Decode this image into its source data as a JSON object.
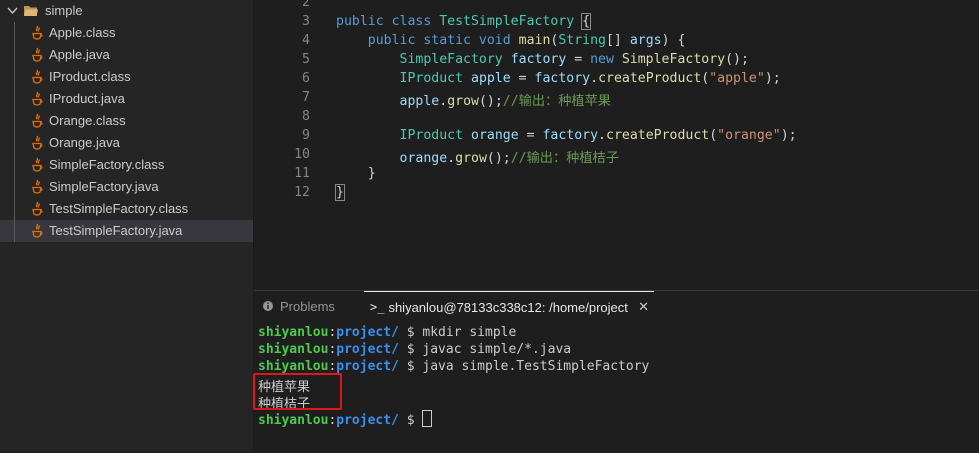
{
  "explorer": {
    "folder": "simple",
    "files": [
      {
        "name": "Apple.class",
        "active": false
      },
      {
        "name": "Apple.java",
        "active": false
      },
      {
        "name": "IProduct.class",
        "active": false
      },
      {
        "name": "IProduct.java",
        "active": false
      },
      {
        "name": "Orange.class",
        "active": false
      },
      {
        "name": "Orange.java",
        "active": false
      },
      {
        "name": "SimpleFactory.class",
        "active": false
      },
      {
        "name": "SimpleFactory.java",
        "active": false
      },
      {
        "name": "TestSimpleFactory.class",
        "active": false
      },
      {
        "name": "TestSimpleFactory.java",
        "active": true
      }
    ]
  },
  "editor": {
    "lines": [
      {
        "n": "2",
        "tokens": []
      },
      {
        "n": "3",
        "tokens": [
          [
            "kw",
            "public "
          ],
          [
            "kw",
            "class "
          ],
          [
            "ty",
            "TestSimpleFactory "
          ],
          [
            "brk",
            "{"
          ]
        ]
      },
      {
        "n": "4",
        "tokens": [
          [
            "pn",
            "    "
          ],
          [
            "kw",
            "public "
          ],
          [
            "kw",
            "static "
          ],
          [
            "kw",
            "void "
          ],
          [
            "fn",
            "main"
          ],
          [
            "pn",
            "("
          ],
          [
            "ty",
            "String"
          ],
          [
            "pn",
            "[] "
          ],
          [
            "vr",
            "args"
          ],
          [
            "pn",
            ") {"
          ]
        ]
      },
      {
        "n": "5",
        "tokens": [
          [
            "pn",
            "        "
          ],
          [
            "ty",
            "SimpleFactory "
          ],
          [
            "vr",
            "factory"
          ],
          [
            "pn",
            " = "
          ],
          [
            "kw",
            "new "
          ],
          [
            "fn",
            "SimpleFactory"
          ],
          [
            "pn",
            "();"
          ]
        ]
      },
      {
        "n": "6",
        "tokens": [
          [
            "pn",
            "        "
          ],
          [
            "ty",
            "IProduct "
          ],
          [
            "vr",
            "apple"
          ],
          [
            "pn",
            " = "
          ],
          [
            "vr",
            "factory"
          ],
          [
            "pn",
            "."
          ],
          [
            "fn",
            "createProduct"
          ],
          [
            "pn",
            "("
          ],
          [
            "st",
            "\"apple\""
          ],
          [
            "pn",
            ");"
          ]
        ]
      },
      {
        "n": "7",
        "tokens": [
          [
            "pn",
            "        "
          ],
          [
            "vr",
            "apple"
          ],
          [
            "pn",
            "."
          ],
          [
            "fn",
            "grow"
          ],
          [
            "pn",
            "();"
          ],
          [
            "cm",
            "//输出：种植苹果"
          ]
        ]
      },
      {
        "n": "8",
        "tokens": []
      },
      {
        "n": "9",
        "tokens": [
          [
            "pn",
            "        "
          ],
          [
            "ty",
            "IProduct "
          ],
          [
            "vr",
            "orange"
          ],
          [
            "pn",
            " = "
          ],
          [
            "vr",
            "factory"
          ],
          [
            "pn",
            "."
          ],
          [
            "fn",
            "createProduct"
          ],
          [
            "pn",
            "("
          ],
          [
            "st",
            "\"orange\""
          ],
          [
            "pn",
            ");"
          ]
        ]
      },
      {
        "n": "10",
        "tokens": [
          [
            "pn",
            "        "
          ],
          [
            "vr",
            "orange"
          ],
          [
            "pn",
            "."
          ],
          [
            "fn",
            "grow"
          ],
          [
            "pn",
            "();"
          ],
          [
            "cm",
            "//输出：种植桔子"
          ]
        ]
      },
      {
        "n": "11",
        "tokens": [
          [
            "pn",
            "    }"
          ]
        ]
      },
      {
        "n": "12",
        "tokens": [
          [
            "brk",
            "}"
          ]
        ]
      }
    ]
  },
  "panel": {
    "tab_problems": "Problems",
    "tab_terminal": "shiyanlou@78133c338c12: /home/project",
    "terminal_lines": [
      {
        "user": "shiyanlou",
        "path": "project/",
        "sep": ":",
        "prompt": " $ ",
        "cmd": "mkdir simple"
      },
      {
        "user": "shiyanlou",
        "path": "project/",
        "sep": ":",
        "prompt": " $ ",
        "cmd": "javac simple/*.java"
      },
      {
        "user": "shiyanlou",
        "path": "project/",
        "sep": ":",
        "prompt": " $ ",
        "cmd": "java simple.TestSimpleFactory"
      },
      {
        "output": "种植苹果"
      },
      {
        "output": "种植桔子"
      },
      {
        "user": "shiyanlou",
        "path": "project/",
        "sep": ":",
        "prompt": " $ ",
        "cmd": "",
        "cursor": true
      }
    ]
  },
  "colors": {
    "editor_bg": "#1e1e1e",
    "sidebar_bg": "#252526",
    "highlight_box": "#e3151a",
    "prompt_user": "#4ec94e",
    "prompt_path": "#3b8eea"
  }
}
